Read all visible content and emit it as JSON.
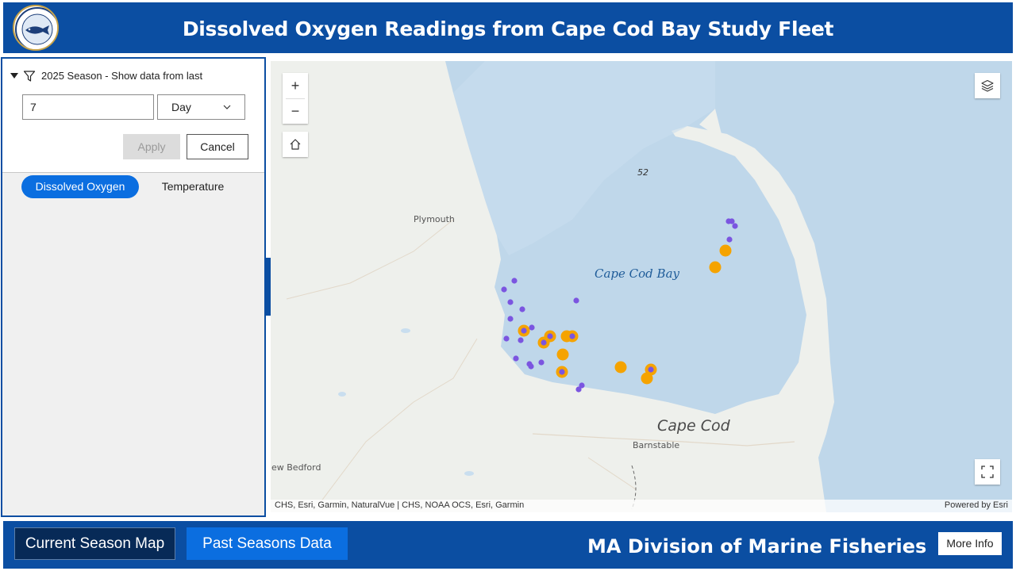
{
  "header": {
    "title": "Dissolved Oxygen Readings from Cape Cod Bay Study Fleet",
    "logo_icon": "ma-marine-fisheries-seal"
  },
  "filter": {
    "label": "2025 Season - Show data from last",
    "value": "7",
    "unit": "Day",
    "apply_label": "Apply",
    "cancel_label": "Cancel"
  },
  "tabs": [
    {
      "label": "Dissolved Oxygen",
      "active": true
    },
    {
      "label": "Temperature",
      "active": false
    }
  ],
  "map": {
    "zoom_in": "+",
    "zoom_out": "−",
    "labels": {
      "bay": "Cape Cod Bay",
      "cape": "Cape Cod",
      "plymouth": "Plymouth",
      "barnstable": "Barnstable",
      "new_bedford": "ew Bedford",
      "depth": "52"
    },
    "attribution": "CHS, Esri, Garmin, NaturalVue | CHS, NOAA OCS, Esri, Garmin",
    "powered_by": "Powered by Esri",
    "colors": {
      "water": "#bfd7ea",
      "land": "#eef0ec",
      "point_purple": "#7b55e0",
      "point_orange": "#f5a300"
    }
  },
  "footer": {
    "current_label": "Current Season Map",
    "past_label": "Past Seasons Data",
    "title": "MA Division of Marine Fisheries",
    "more_label": "More Info"
  }
}
